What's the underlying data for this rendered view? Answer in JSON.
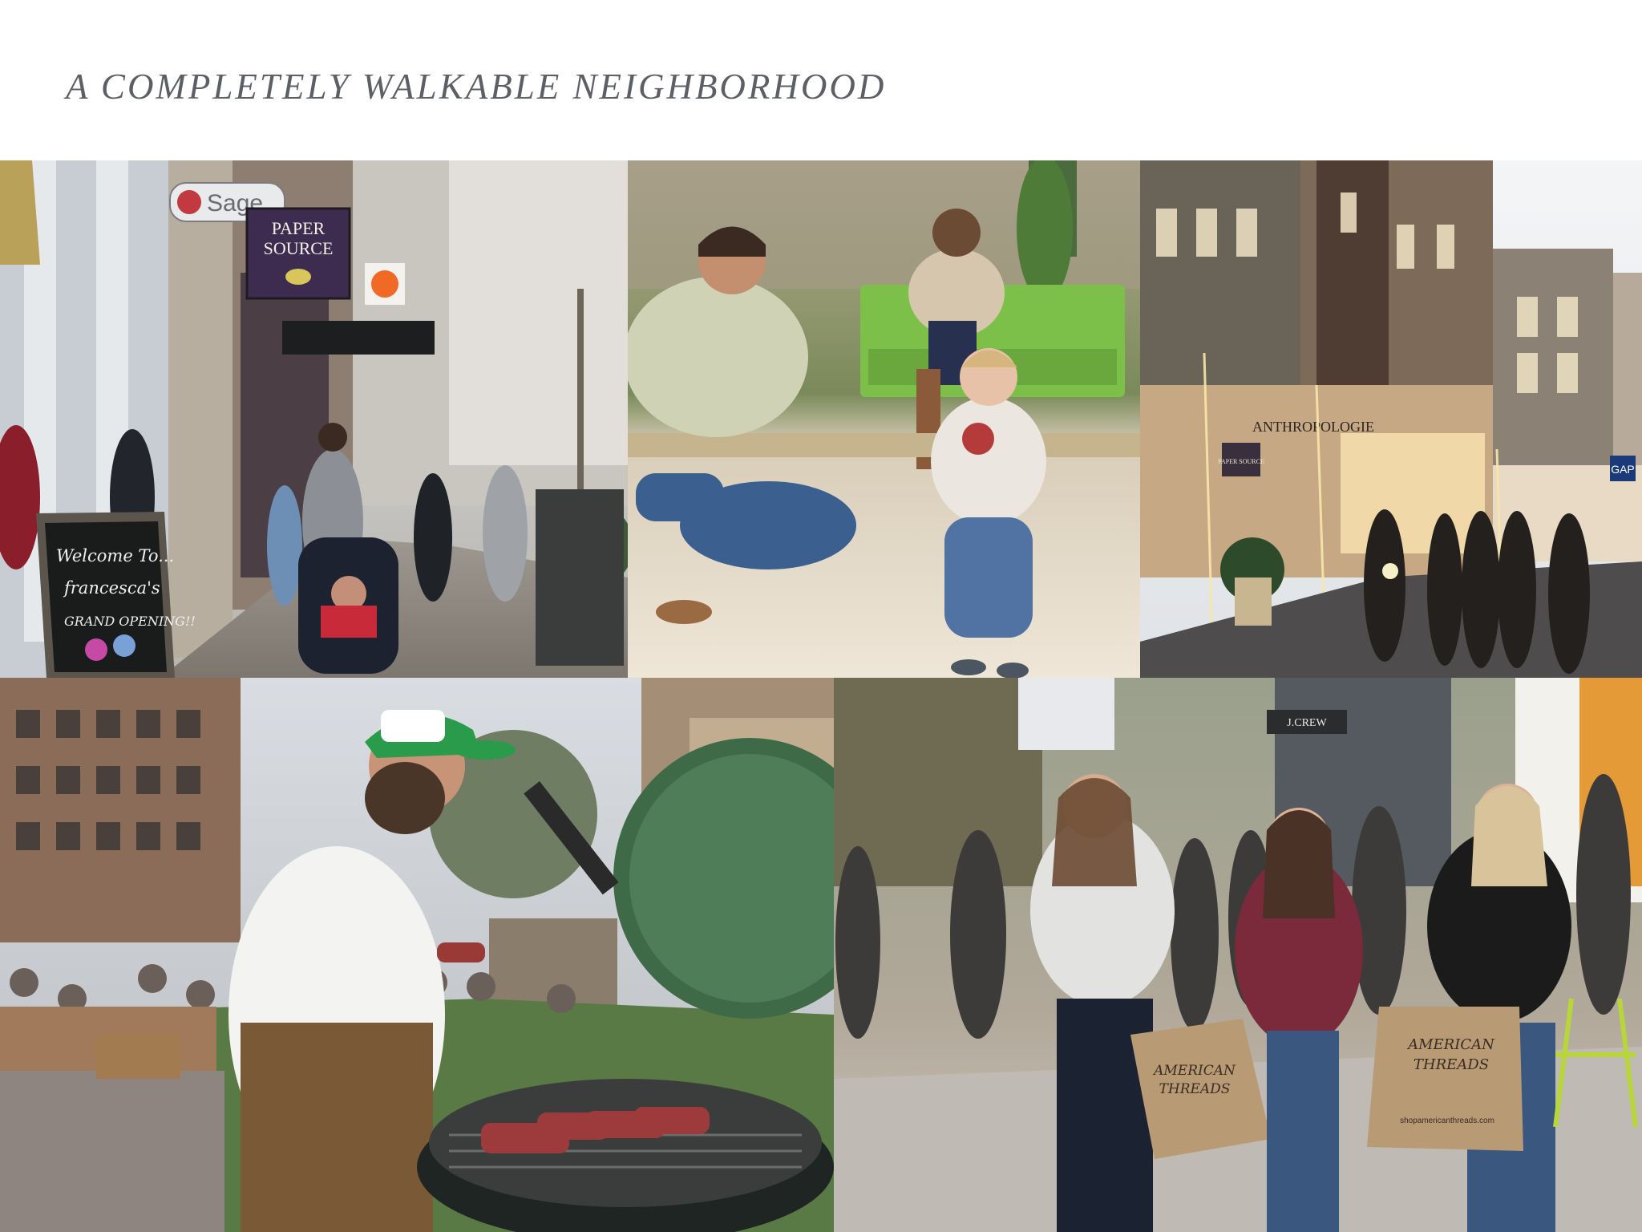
{
  "header": {
    "title": "A COMPLETELY WALKABLE NEIGHBORHOOD"
  },
  "photos": {
    "storefront": {
      "sign_sage": "Sage",
      "sign_paper_line1": "PAPER",
      "sign_paper_line2": "SOURCE",
      "chalkboard_line1": "Welcome To...",
      "chalkboard_line2": "francesca's",
      "chalkboard_line3": "GRAND OPENING!!"
    },
    "evening_street": {
      "sign_anthro": "ANTHROPOLOGIE",
      "sign_paper": "PAPER SOURCE",
      "sign_gap": "GAP"
    },
    "shoppers": {
      "sign_jcrew": "J.CREW",
      "bag_brand_line1": "AMERICAN",
      "bag_brand_line2": "THREADS",
      "bag_url": "shopamericanthreads.com"
    }
  }
}
